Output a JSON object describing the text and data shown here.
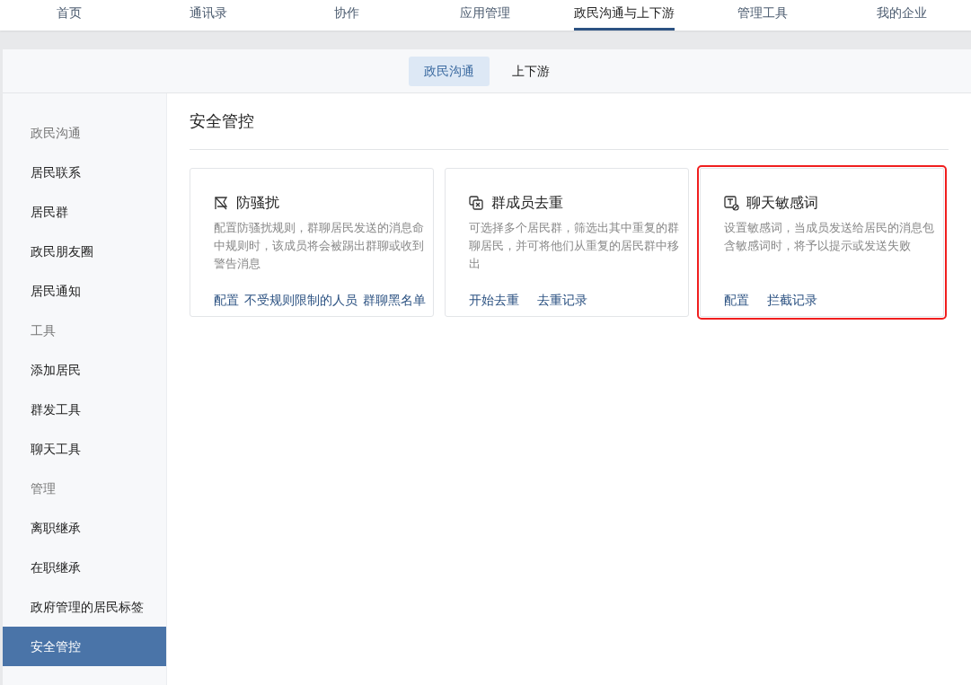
{
  "top_nav": [
    {
      "label": "首页",
      "selected": false
    },
    {
      "label": "通讯录",
      "selected": false
    },
    {
      "label": "协作",
      "selected": false
    },
    {
      "label": "应用管理",
      "selected": false
    },
    {
      "label": "政民沟通与上下游",
      "selected": true
    },
    {
      "label": "管理工具",
      "selected": false
    },
    {
      "label": "我的企业",
      "selected": false
    }
  ],
  "sub_tabs": [
    {
      "label": "政民沟通",
      "selected": true
    },
    {
      "label": "上下游",
      "selected": false
    }
  ],
  "sidebar": {
    "items": [
      {
        "kind": "heading",
        "label": "政民沟通"
      },
      {
        "kind": "item",
        "label": "居民联系",
        "selected": false
      },
      {
        "kind": "item",
        "label": "居民群",
        "selected": false
      },
      {
        "kind": "item",
        "label": "政民朋友圈",
        "selected": false
      },
      {
        "kind": "item",
        "label": "居民通知",
        "selected": false
      },
      {
        "kind": "heading",
        "label": "工具"
      },
      {
        "kind": "item",
        "label": "添加居民",
        "selected": false
      },
      {
        "kind": "item",
        "label": "群发工具",
        "selected": false
      },
      {
        "kind": "item",
        "label": "聊天工具",
        "selected": false
      },
      {
        "kind": "heading",
        "label": "管理"
      },
      {
        "kind": "item",
        "label": "离职继承",
        "selected": false
      },
      {
        "kind": "item",
        "label": "在职继承",
        "selected": false
      },
      {
        "kind": "item",
        "label": "政府管理的居民标签",
        "selected": false
      },
      {
        "kind": "item",
        "label": "安全管控",
        "selected": true
      }
    ]
  },
  "page_title": "安全管控",
  "cards": [
    {
      "title": "防骚扰",
      "description": "配置防骚扰规则，群聊居民发送的消息命中规则时，该成员将会被踢出群聊或收到警告消息",
      "links": [
        "配置",
        "不受规则限制的人员",
        "群聊黑名单"
      ],
      "highlighted": false
    },
    {
      "title": "群成员去重",
      "description": "可选择多个居民群，筛选出其中重复的群聊居民，并可将他们从重复的居民群中移出",
      "links": [
        "开始去重",
        "去重记录"
      ],
      "highlighted": false
    },
    {
      "title": "聊天敏感词",
      "description": "设置敏感词，当成员发送给居民的消息包含敏感词时，将予以提示或发送失败",
      "links": [
        "配置",
        "拦截记录"
      ],
      "highlighted": true
    }
  ]
}
